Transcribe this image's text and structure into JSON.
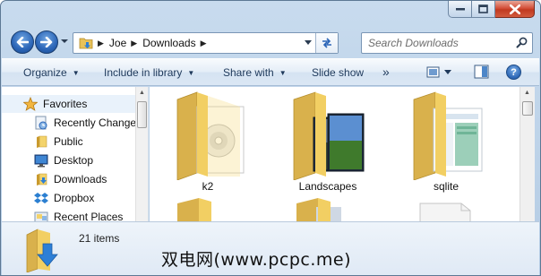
{
  "window": {
    "caption_buttons": [
      "minimize",
      "maximize",
      "close"
    ]
  },
  "nav": {
    "back_icon": "back-arrow-icon",
    "forward_icon": "forward-arrow-icon"
  },
  "address": {
    "crumbs": [
      "Joe",
      "Downloads"
    ]
  },
  "search": {
    "placeholder": "Search Downloads"
  },
  "toolbar": {
    "organize": "Organize",
    "include": "Include in library",
    "share": "Share with",
    "slideshow": "Slide show",
    "more": "»",
    "help": "?"
  },
  "sidebar": {
    "favorites": "Favorites",
    "items": [
      {
        "label": "Recently Changed",
        "icon": "recent-icon"
      },
      {
        "label": "Public",
        "icon": "folder-icon"
      },
      {
        "label": "Desktop",
        "icon": "desktop-icon"
      },
      {
        "label": "Downloads",
        "icon": "downloads-icon"
      },
      {
        "label": "Dropbox",
        "icon": "dropbox-icon"
      },
      {
        "label": "Recent Places",
        "icon": "recent-places-icon"
      }
    ]
  },
  "files": [
    {
      "name": "k2",
      "type": "folder-disc"
    },
    {
      "name": "Landscapes",
      "type": "folder-photos"
    },
    {
      "name": "sqlite",
      "type": "folder-document"
    }
  ],
  "status": {
    "item_count": "21 items"
  },
  "watermark": "双电网(www.pcpc.me)",
  "colors": {
    "accent": "#2b65b7",
    "folder": "#f3d36b",
    "close": "#c13a20",
    "chrome": "#bcd2e8"
  }
}
